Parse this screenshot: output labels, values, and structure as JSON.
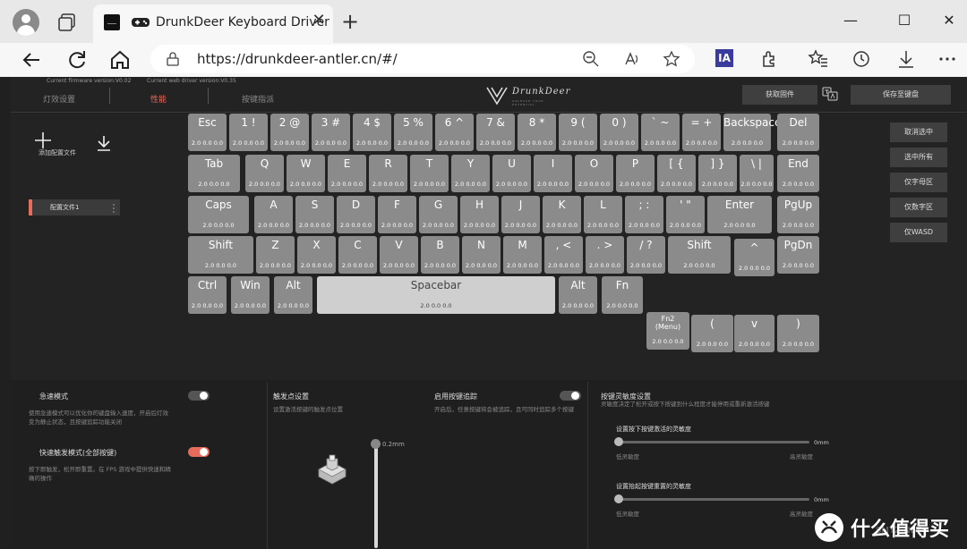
{
  "browser": {
    "tab_title": "DrunkDeer Keyboard Driver",
    "tab_close": "✕",
    "new_tab": "+",
    "url": "https://drunkdeer-antler.cn/#/",
    "ia_label": "IA"
  },
  "app": {
    "firmware_version": "Current firmware version:V0.02",
    "web_driver_version": "Current web driver version:V0.35",
    "nav_tabs": [
      {
        "label": "灯效设置"
      },
      {
        "label": "性能"
      },
      {
        "label": "按键指派"
      }
    ],
    "logo_text": "DrunkDeer",
    "logo_sub": "UNLEASH YOUR POTENTIAL",
    "get_firmware": "获取固件",
    "save_to_keyboard": "保存至键盘",
    "add_config": "添加配置文件",
    "config_item": "配置文件1",
    "right_buttons": [
      {
        "label": "取消选中"
      },
      {
        "label": "选中所有"
      },
      {
        "label": "仅字母区"
      },
      {
        "label": "仅数字区"
      },
      {
        "label": "仅WASD"
      }
    ]
  },
  "keyboard": {
    "value_text": "2.0  0.0  0.0",
    "rows": [
      [
        {
          "k": "Esc"
        },
        {
          "k": "1 !"
        },
        {
          "k": "2 @"
        },
        {
          "k": "3 #"
        },
        {
          "k": "4 $"
        },
        {
          "k": "5 %"
        },
        {
          "k": "6 ^"
        },
        {
          "k": "7 &"
        },
        {
          "k": "8 *"
        },
        {
          "k": "9 ("
        },
        {
          "k": "0 )"
        },
        {
          "k": "` ~"
        },
        {
          "k": "= +"
        },
        {
          "k": "Backspace"
        },
        {
          "k": "Del"
        }
      ],
      [
        {
          "k": "Tab"
        },
        {
          "k": "Q"
        },
        {
          "k": "W"
        },
        {
          "k": "E"
        },
        {
          "k": "R"
        },
        {
          "k": "T"
        },
        {
          "k": "Y"
        },
        {
          "k": "U"
        },
        {
          "k": "I"
        },
        {
          "k": "O"
        },
        {
          "k": "P"
        },
        {
          "k": "[ {"
        },
        {
          "k": "] }"
        },
        {
          "k": "\\ |"
        },
        {
          "k": "End"
        }
      ],
      [
        {
          "k": "Caps"
        },
        {
          "k": "A"
        },
        {
          "k": "S"
        },
        {
          "k": "D"
        },
        {
          "k": "F"
        },
        {
          "k": "G"
        },
        {
          "k": "H"
        },
        {
          "k": "J"
        },
        {
          "k": "K"
        },
        {
          "k": "L"
        },
        {
          "k": "; :"
        },
        {
          "k": "' \""
        },
        {
          "k": "Enter"
        },
        {
          "k": "PgUp"
        }
      ],
      [
        {
          "k": "Shift"
        },
        {
          "k": "Z"
        },
        {
          "k": "X"
        },
        {
          "k": "C"
        },
        {
          "k": "V"
        },
        {
          "k": "B"
        },
        {
          "k": "N"
        },
        {
          "k": "M"
        },
        {
          "k": ", <"
        },
        {
          "k": ". >"
        },
        {
          "k": "/ ?"
        },
        {
          "k": "Shift"
        },
        {
          "k": "^"
        },
        {
          "k": "PgDn"
        }
      ],
      [
        {
          "k": "Ctrl"
        },
        {
          "k": "Win"
        },
        {
          "k": "Alt"
        },
        {
          "k": "Spacebar"
        },
        {
          "k": "Alt"
        },
        {
          "k": "Fn"
        },
        {
          "k": "Fn2\n(Menu)"
        },
        {
          "k": "("
        },
        {
          "k": "v"
        },
        {
          "k": ")"
        }
      ]
    ]
  },
  "settings": {
    "rapid_mode": {
      "label": "急速模式",
      "desc": "使用急速模式可以优化你的键盘输入速度，开启后灯效变为静止状态，且按键追踪功能关闭",
      "enabled": false
    },
    "quick_trigger": {
      "label": "快速触发模式(全部按键)",
      "desc": "按下即触发，松开即重置。在 FPS 游戏中提供快速和精确的操作",
      "enabled": true
    },
    "actuation": {
      "label": "触发点设置",
      "desc": "设置激活按键的触发点位置",
      "value": "0.2mm"
    },
    "key_tracking": {
      "label": "启用按键追踪",
      "desc": "开启后，任意按键将会被追踪，且可同时追踪多个按键",
      "enabled": false
    },
    "sensitivity": {
      "label": "按键灵敏度设置",
      "desc": "灵敏度决定了松开或按下按键到什么程度才能停用或重新激活按键",
      "press": {
        "label": "设置按下按键激活的灵敏度",
        "value": "0mm",
        "min_label": "低灵敏度",
        "max_label": "高灵敏度"
      },
      "release": {
        "label": "设置抬起按键重置的灵敏度",
        "value": "0mm",
        "min_label": "低灵敏度",
        "max_label": "高灵敏度"
      }
    }
  },
  "watermark": {
    "text": "什么值得买",
    "sub": "SMYZ.NET"
  }
}
